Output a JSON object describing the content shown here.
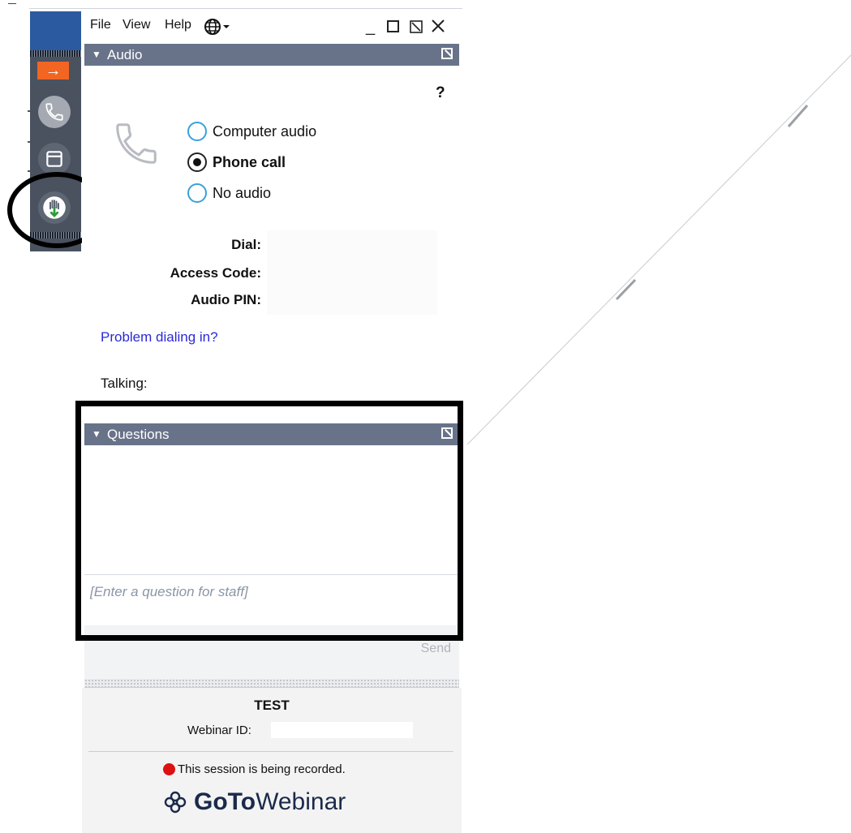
{
  "menu": {
    "file": "File",
    "view": "View",
    "help": "Help"
  },
  "audio": {
    "section_title": "Audio",
    "help": "?",
    "options": [
      "Computer audio",
      "Phone call",
      "No audio"
    ],
    "selected": "Phone call",
    "dial_labels": [
      "Dial:",
      "Access Code:",
      "Audio PIN:"
    ],
    "problem_link": "Problem dialing in?",
    "talking": "Talking:"
  },
  "questions": {
    "section_title": "Questions",
    "placeholder": "[Enter a question for staff]",
    "send": "Send"
  },
  "footer": {
    "webinar_name": "TEST",
    "webinar_id_label": "Webinar ID:",
    "recording_notice": "This session is being recorded.",
    "brand_bold": "GoTo",
    "brand_regular": "Webinar"
  },
  "colors": {
    "header_bg": "#68738a",
    "rail_bg": "#4a5260",
    "rail_accent": "#f26522",
    "link": "#2a2ad6",
    "record_dot": "#dd1111",
    "radio_ring": "#3aa0dc"
  },
  "icons": {
    "rail": [
      "arrow-right-icon",
      "phone-icon",
      "window-icon",
      "raise-hand-icon"
    ],
    "menu": [
      "globe-icon",
      "minimize-icon",
      "maximize-icon",
      "restore-icon",
      "close-icon"
    ]
  }
}
